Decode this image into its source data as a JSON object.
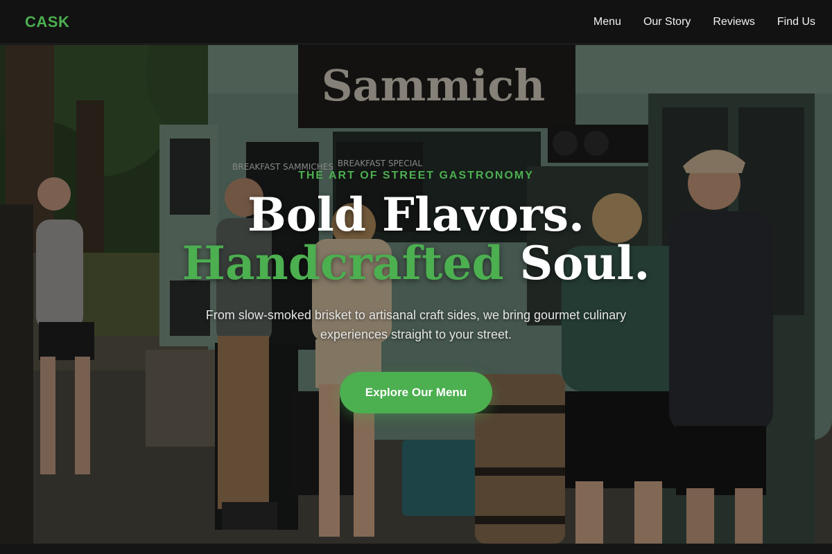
{
  "nav": {
    "brand": "CASK",
    "links": [
      "Menu",
      "Our Story",
      "Reviews",
      "Find Us"
    ]
  },
  "hero": {
    "eyebrow": "The Art of Street Gastronomy",
    "headline_line1": "Bold Flavors.",
    "headline_accent": "Handcrafted",
    "headline_rest": " Soul.",
    "subtext": "From slow-smoked brisket to artisanal craft sides, we bring gourmet culinary experiences straight to your street.",
    "cta_label": "Explore Our Menu",
    "truck_sign": "Sammich",
    "chalkboard_left": "BREAKFAST SAMMICHES",
    "chalkboard_right": "BREAKFAST SPECIAL"
  },
  "colors": {
    "accent": "#4caf50",
    "nav_bg": "#121212"
  }
}
